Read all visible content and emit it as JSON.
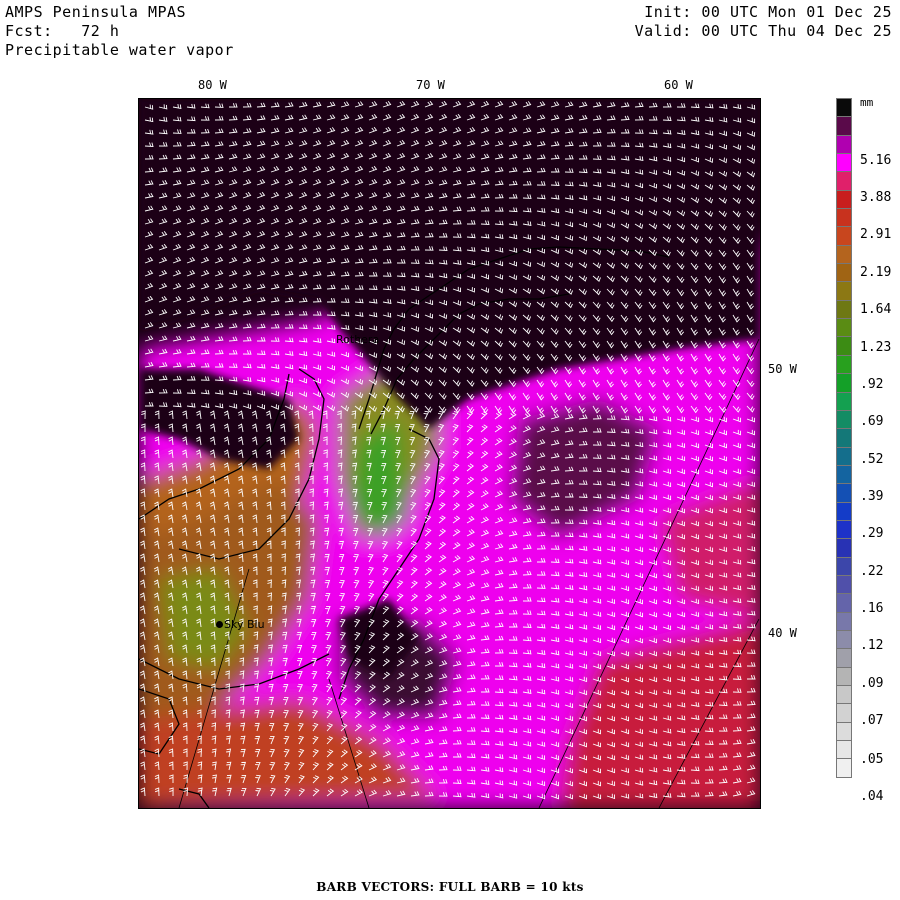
{
  "header": {
    "model": "AMPS Peninsula MPAS",
    "forecast": "Fcst:   72 h",
    "field": "Precipitable water vapor",
    "init": "Init: 00 UTC Mon 01 Dec 25",
    "valid": "Valid: 00 UTC Thu 04 Dec 25"
  },
  "lon_labels": [
    "80 W",
    "70 W",
    "60 W"
  ],
  "lat_labels": [
    "50 W",
    "40 W"
  ],
  "stations": [
    "Rothera",
    "Sky Blu"
  ],
  "legend": {
    "unit": "mm",
    "labels": [
      "5.16",
      "3.88",
      "2.91",
      "2.19",
      "1.64",
      "1.23",
      ".92",
      ".69",
      ".52",
      ".39",
      ".29",
      ".22",
      ".16",
      ".12",
      ".09",
      ".07",
      ".05",
      ".04"
    ],
    "colors": [
      "#0a0a0a",
      "#5a0a4a",
      "#b000b0",
      "#ff00ff",
      "#e0206a",
      "#c81e1e",
      "#c8321e",
      "#c8461e",
      "#b4641e",
      "#a06414",
      "#8c7814",
      "#6e7814",
      "#5a8c14",
      "#3c8c14",
      "#28a01e",
      "#14a028",
      "#14a050",
      "#148c64",
      "#147878",
      "#146e8c",
      "#1464a0",
      "#1450b4",
      "#143cc8",
      "#1e32c8",
      "#2832b4",
      "#3c46aa",
      "#5050aa",
      "#6464aa",
      "#7878aa",
      "#8c8caa",
      "#a0a0aa",
      "#b4b4b4",
      "#c8c8c8",
      "#d2d2d2",
      "#dcdcdc",
      "#e6e6e6",
      "#f0f0f0"
    ]
  },
  "footer": "BARB VECTORS:  FULL BARB = 10 kts"
}
